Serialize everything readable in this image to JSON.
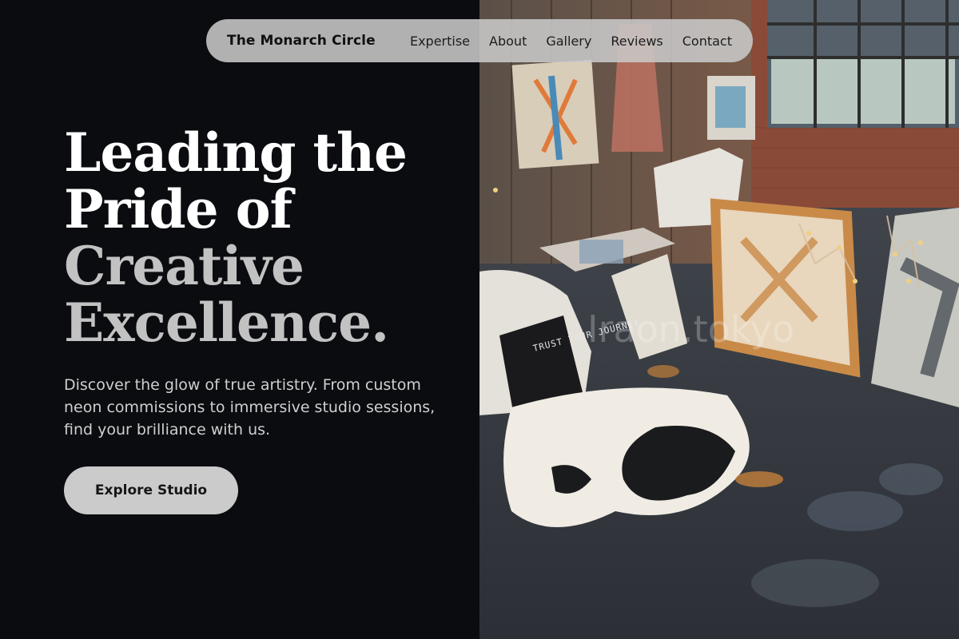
{
  "nav": {
    "brand": "The Monarch Circle",
    "links": [
      "Expertise",
      "About",
      "Gallery",
      "Reviews",
      "Contact"
    ]
  },
  "hero": {
    "headline_line1": "Leading the",
    "headline_line2": "Pride of",
    "headline_line3": "Creative",
    "headline_line4": "Excellence.",
    "subtext": "Discover the glow of true artistry. From custom neon commissions to immersive studio sessions, find your brilliance with us.",
    "cta_label": "Explore Studio"
  },
  "photo": {
    "sign_text": "TRUST YOUR JOURNEY",
    "watermark": "Iraon.tokyo"
  },
  "colors": {
    "background": "#0b0c10",
    "nav_pill": "#c8c8c8",
    "headline_white": "#ffffff",
    "headline_muted": "#c2c2c2",
    "button": "#cbcbcb"
  }
}
